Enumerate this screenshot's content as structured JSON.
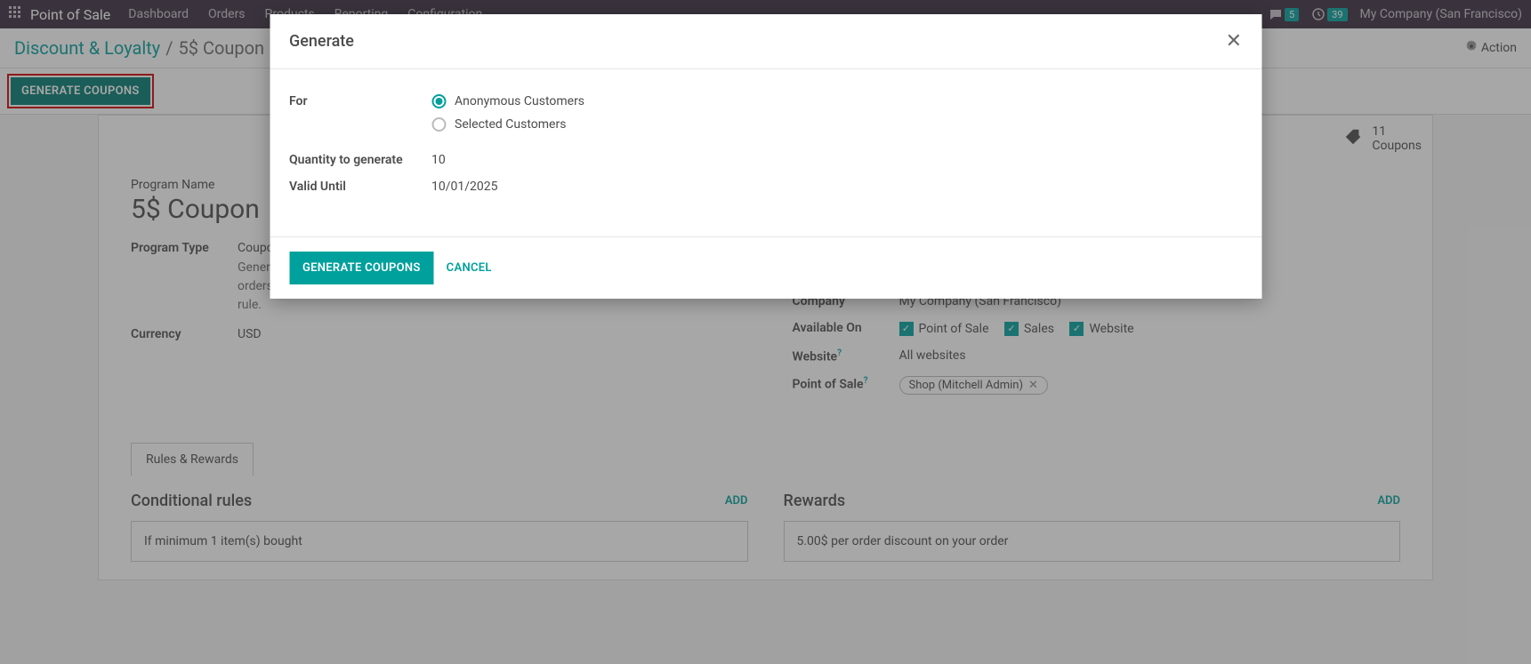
{
  "topnav": {
    "brand": "Point of Sale",
    "menu": [
      "Dashboard",
      "Orders",
      "Products",
      "Reporting",
      "Configuration"
    ],
    "msg_badge": "5",
    "clock_badge": "39",
    "company": "My Company (San Francisco)"
  },
  "breadcrumb": {
    "root": "Discount & Loyalty",
    "sep": "/",
    "current": "5$ Coupon",
    "action": "Action"
  },
  "genbar": {
    "button": "GENERATE COUPONS"
  },
  "sheet": {
    "coupons_count": "11",
    "coupons_label": "Coupons",
    "program_name_label": "Program Name",
    "program_name": "5$ Coupon",
    "left": {
      "program_type_label": "Program Type",
      "program_type": "Coupons",
      "program_desc": "Generate and share unique coupons with your customers. They can be used on regular orders to claim the Reward. You can define constraints on its usage through conditional rule.",
      "currency_label": "Currency",
      "currency": "USD"
    },
    "right": {
      "company_label": "Company",
      "company": "My Company (San Francisco)",
      "available_label": "Available On",
      "available": [
        "Point of Sale",
        "Sales",
        "Website"
      ],
      "website_label": "Website",
      "website_value": "All websites",
      "pos_label": "Point of Sale",
      "pos_tag": "Shop (Mitchell Admin)"
    },
    "tab": "Rules & Rewards",
    "rules_title": "Conditional rules",
    "rewards_title": "Rewards",
    "add": "ADD",
    "rule_text": "If minimum 1 item(s) bought",
    "reward_text": "5.00$ per order discount on your order"
  },
  "modal": {
    "title": "Generate",
    "for_label": "For",
    "opt1": "Anonymous Customers",
    "opt2": "Selected Customers",
    "qty_label": "Quantity to generate",
    "qty_value": "10",
    "valid_label": "Valid Until",
    "valid_value": "10/01/2025",
    "primary": "GENERATE COUPONS",
    "secondary": "CANCEL"
  }
}
